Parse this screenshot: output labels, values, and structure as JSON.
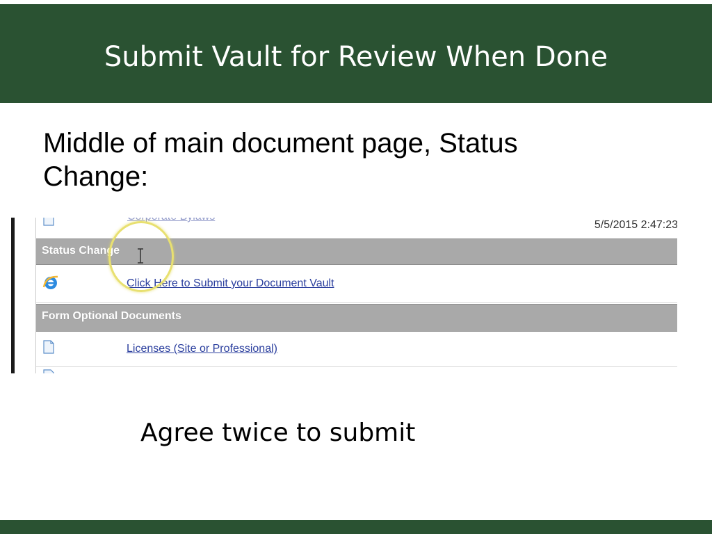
{
  "slide": {
    "title": "Submit Vault for Review When Done",
    "subtitle": "Middle of main document page, Status Change:",
    "caption": "Agree twice to submit"
  },
  "screenshot": {
    "top_link": "Corporate Bylaws",
    "timestamp": "5/5/2015 2:47:23",
    "status_header": "Status Change",
    "submit_link": "Click Here to Submit your Document Vault",
    "optional_header": "Form Optional Documents",
    "licenses_link": "Licenses (Site or Professional)"
  },
  "colors": {
    "title_bar": "#2a5232",
    "section_header": "#a9a9a9",
    "link": "#2b3f9e",
    "highlight_circle": "#e8e070"
  },
  "icons": {
    "document": "document-icon",
    "browser": "internet-explorer-icon",
    "cursor": "text-cursor-icon"
  }
}
